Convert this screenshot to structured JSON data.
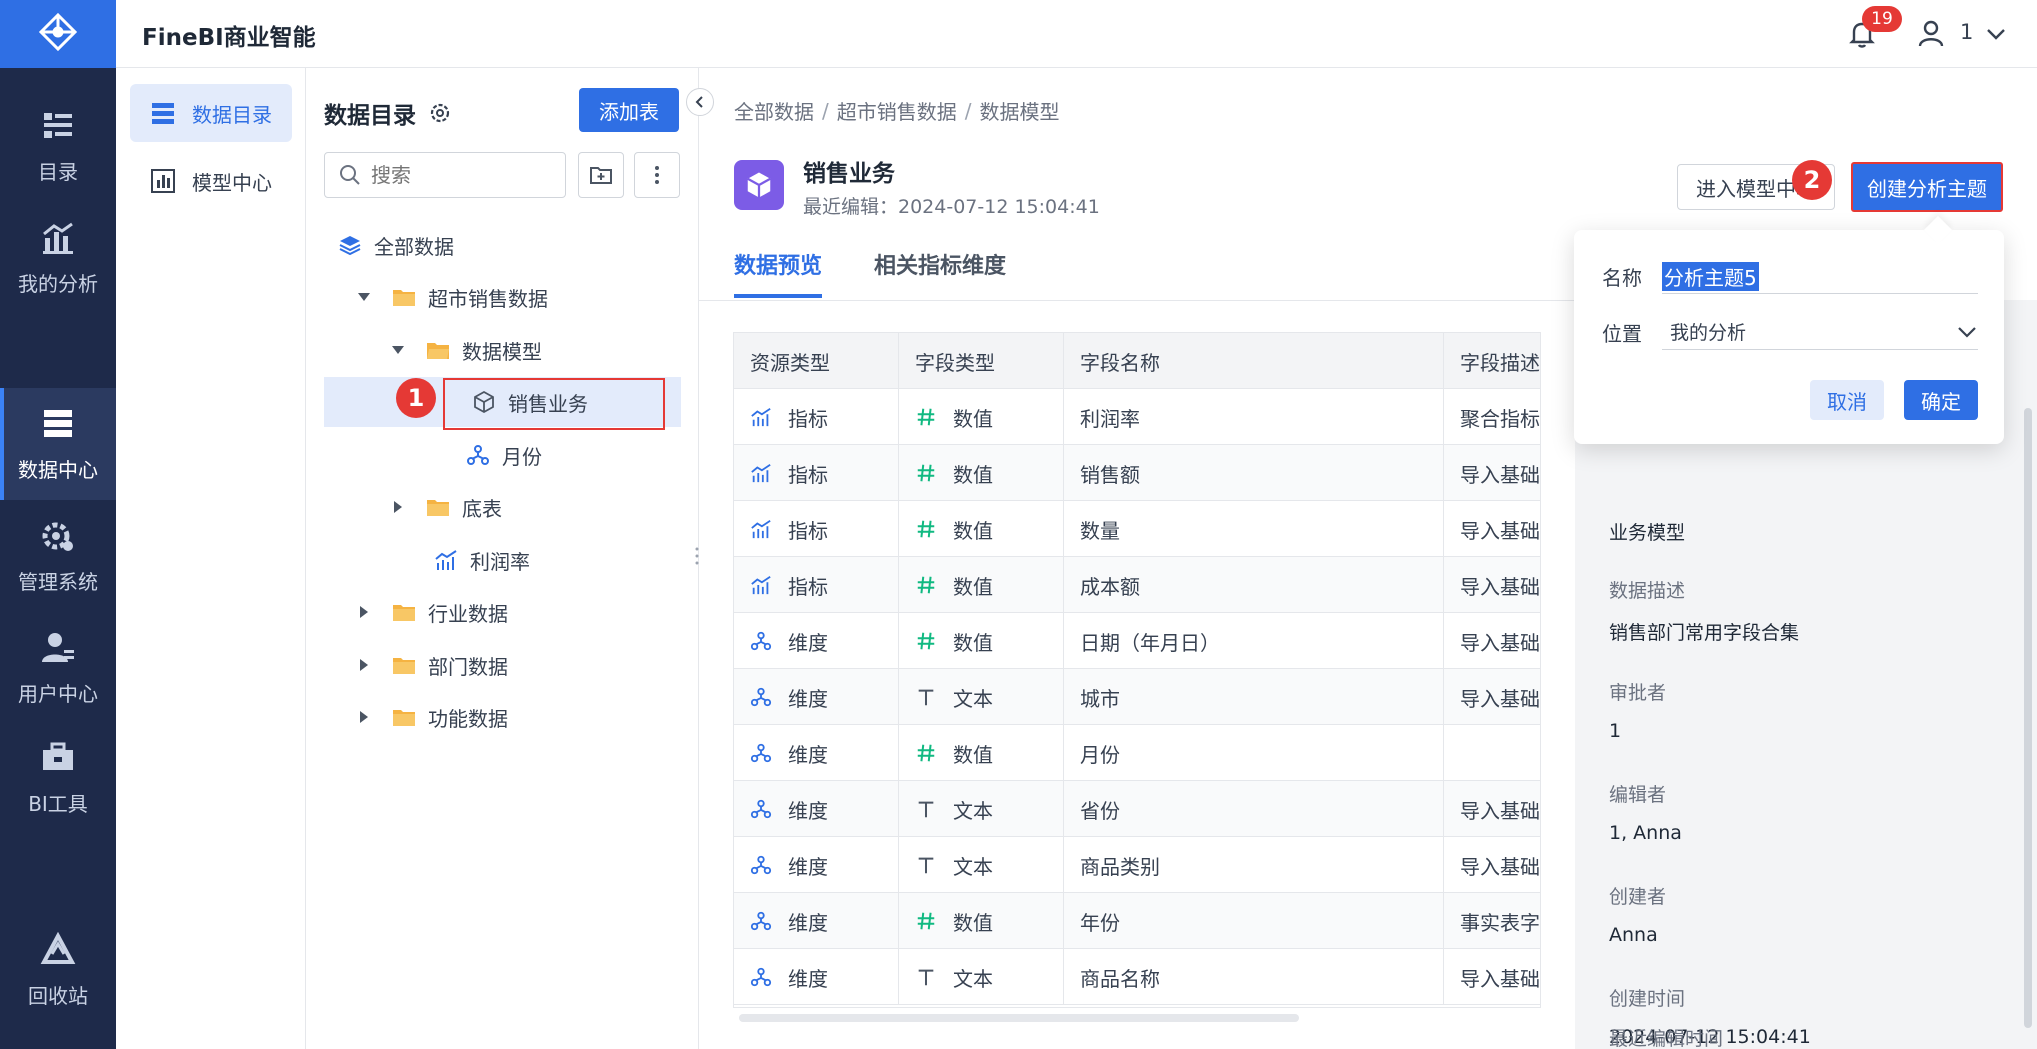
{
  "header": {
    "brand": "FineBI商业智能",
    "notification_count": "19",
    "user_name": "1"
  },
  "rail": {
    "items": [
      {
        "label": "目录",
        "icon": "catalog-icon"
      },
      {
        "label": "我的分析",
        "icon": "analysis-chart-icon"
      },
      {
        "label": "数据中心",
        "icon": "data-center-icon",
        "active": true
      },
      {
        "label": "管理系统",
        "icon": "gear-system-icon"
      },
      {
        "label": "用户中心",
        "icon": "user-center-icon"
      },
      {
        "label": "BI工具",
        "icon": "toolbox-icon"
      },
      {
        "label": "回收站",
        "icon": "recycle-icon"
      }
    ]
  },
  "subnav": {
    "items": [
      {
        "label": "数据目录",
        "active": true
      },
      {
        "label": "模型中心"
      }
    ],
    "collapse_label": "收起"
  },
  "tree": {
    "title": "数据目录",
    "add_table_label": "添加表",
    "search_placeholder": "搜索",
    "nodes": [
      {
        "label": "全部数据",
        "icon": "layers-icon"
      },
      {
        "label": "超市销售数据",
        "icon": "folder-icon",
        "expanded": true
      },
      {
        "label": "数据模型",
        "icon": "folder-icon",
        "expanded": true
      },
      {
        "label": "销售业务",
        "icon": "cube-icon",
        "selected": true
      },
      {
        "label": "月份",
        "icon": "dimension-icon"
      },
      {
        "label": "底表",
        "icon": "folder-icon"
      },
      {
        "label": "利润率",
        "icon": "metric-icon"
      },
      {
        "label": "行业数据",
        "icon": "folder-icon"
      },
      {
        "label": "部门数据",
        "icon": "folder-icon"
      },
      {
        "label": "功能数据",
        "icon": "folder-icon"
      }
    ]
  },
  "steps": {
    "one": "1",
    "two": "2"
  },
  "main": {
    "breadcrumb": [
      "全部数据",
      "超市销售数据",
      "数据模型"
    ],
    "breadcrumb_sep": "/",
    "model_name": "销售业务",
    "last_edit": "最近编辑：2024-07-12 15:04:41",
    "enter_model_label": "进入模型中心",
    "create_theme_label": "创建分析主题",
    "tabs": [
      "数据预览",
      "相关指标维度"
    ]
  },
  "table": {
    "headers": [
      "资源类型",
      "字段类型",
      "字段名称",
      "字段描述"
    ],
    "rows": [
      {
        "res": "指标",
        "res_icon": "metric",
        "type": "数值",
        "type_icon": "hash",
        "name": "利润率",
        "desc": "聚合指标"
      },
      {
        "res": "指标",
        "res_icon": "metric",
        "type": "数值",
        "type_icon": "hash",
        "name": "销售额",
        "desc": "导入基础"
      },
      {
        "res": "指标",
        "res_icon": "metric",
        "type": "数值",
        "type_icon": "hash",
        "name": "数量",
        "desc": "导入基础"
      },
      {
        "res": "指标",
        "res_icon": "metric",
        "type": "数值",
        "type_icon": "hash",
        "name": "成本额",
        "desc": "导入基础"
      },
      {
        "res": "维度",
        "res_icon": "dimension",
        "type": "数值",
        "type_icon": "hash",
        "name": "日期（年月日）",
        "desc": "导入基础"
      },
      {
        "res": "维度",
        "res_icon": "dimension",
        "type": "文本",
        "type_icon": "text",
        "name": "城市",
        "desc": "导入基础"
      },
      {
        "res": "维度",
        "res_icon": "dimension",
        "type": "数值",
        "type_icon": "hash",
        "name": "月份",
        "desc": ""
      },
      {
        "res": "维度",
        "res_icon": "dimension",
        "type": "文本",
        "type_icon": "text",
        "name": "省份",
        "desc": "导入基础"
      },
      {
        "res": "维度",
        "res_icon": "dimension",
        "type": "文本",
        "type_icon": "text",
        "name": "商品类别",
        "desc": "导入基础"
      },
      {
        "res": "维度",
        "res_icon": "dimension",
        "type": "数值",
        "type_icon": "hash",
        "name": "年份",
        "desc": "事实表字"
      },
      {
        "res": "维度",
        "res_icon": "dimension",
        "type": "文本",
        "type_icon": "text",
        "name": "商品名称",
        "desc": "导入基础"
      }
    ]
  },
  "info": {
    "type_value": "业务模型",
    "desc_label": "数据描述",
    "desc_value": "销售部门常用字段合集",
    "approver_label": "审批者",
    "approver_value": "1",
    "editor_label": "编辑者",
    "editor_value": "1, Anna",
    "creator_label": "创建者",
    "creator_value": "Anna",
    "created_label": "创建时间",
    "created_value": "2024-07-12 15:04:41",
    "last_edit_label": "最近编辑时间"
  },
  "popover": {
    "name_label": "名称",
    "name_value": "分析主题5",
    "location_label": "位置",
    "location_value": "我的分析",
    "cancel_label": "取消",
    "ok_label": "确定"
  },
  "colors": {
    "accent": "#2f6fe4",
    "rail_bg": "#1e2a4a",
    "highlight_red": "#e53935",
    "model_icon_bg": "#7c5ce6",
    "folder": "#f5b342"
  }
}
